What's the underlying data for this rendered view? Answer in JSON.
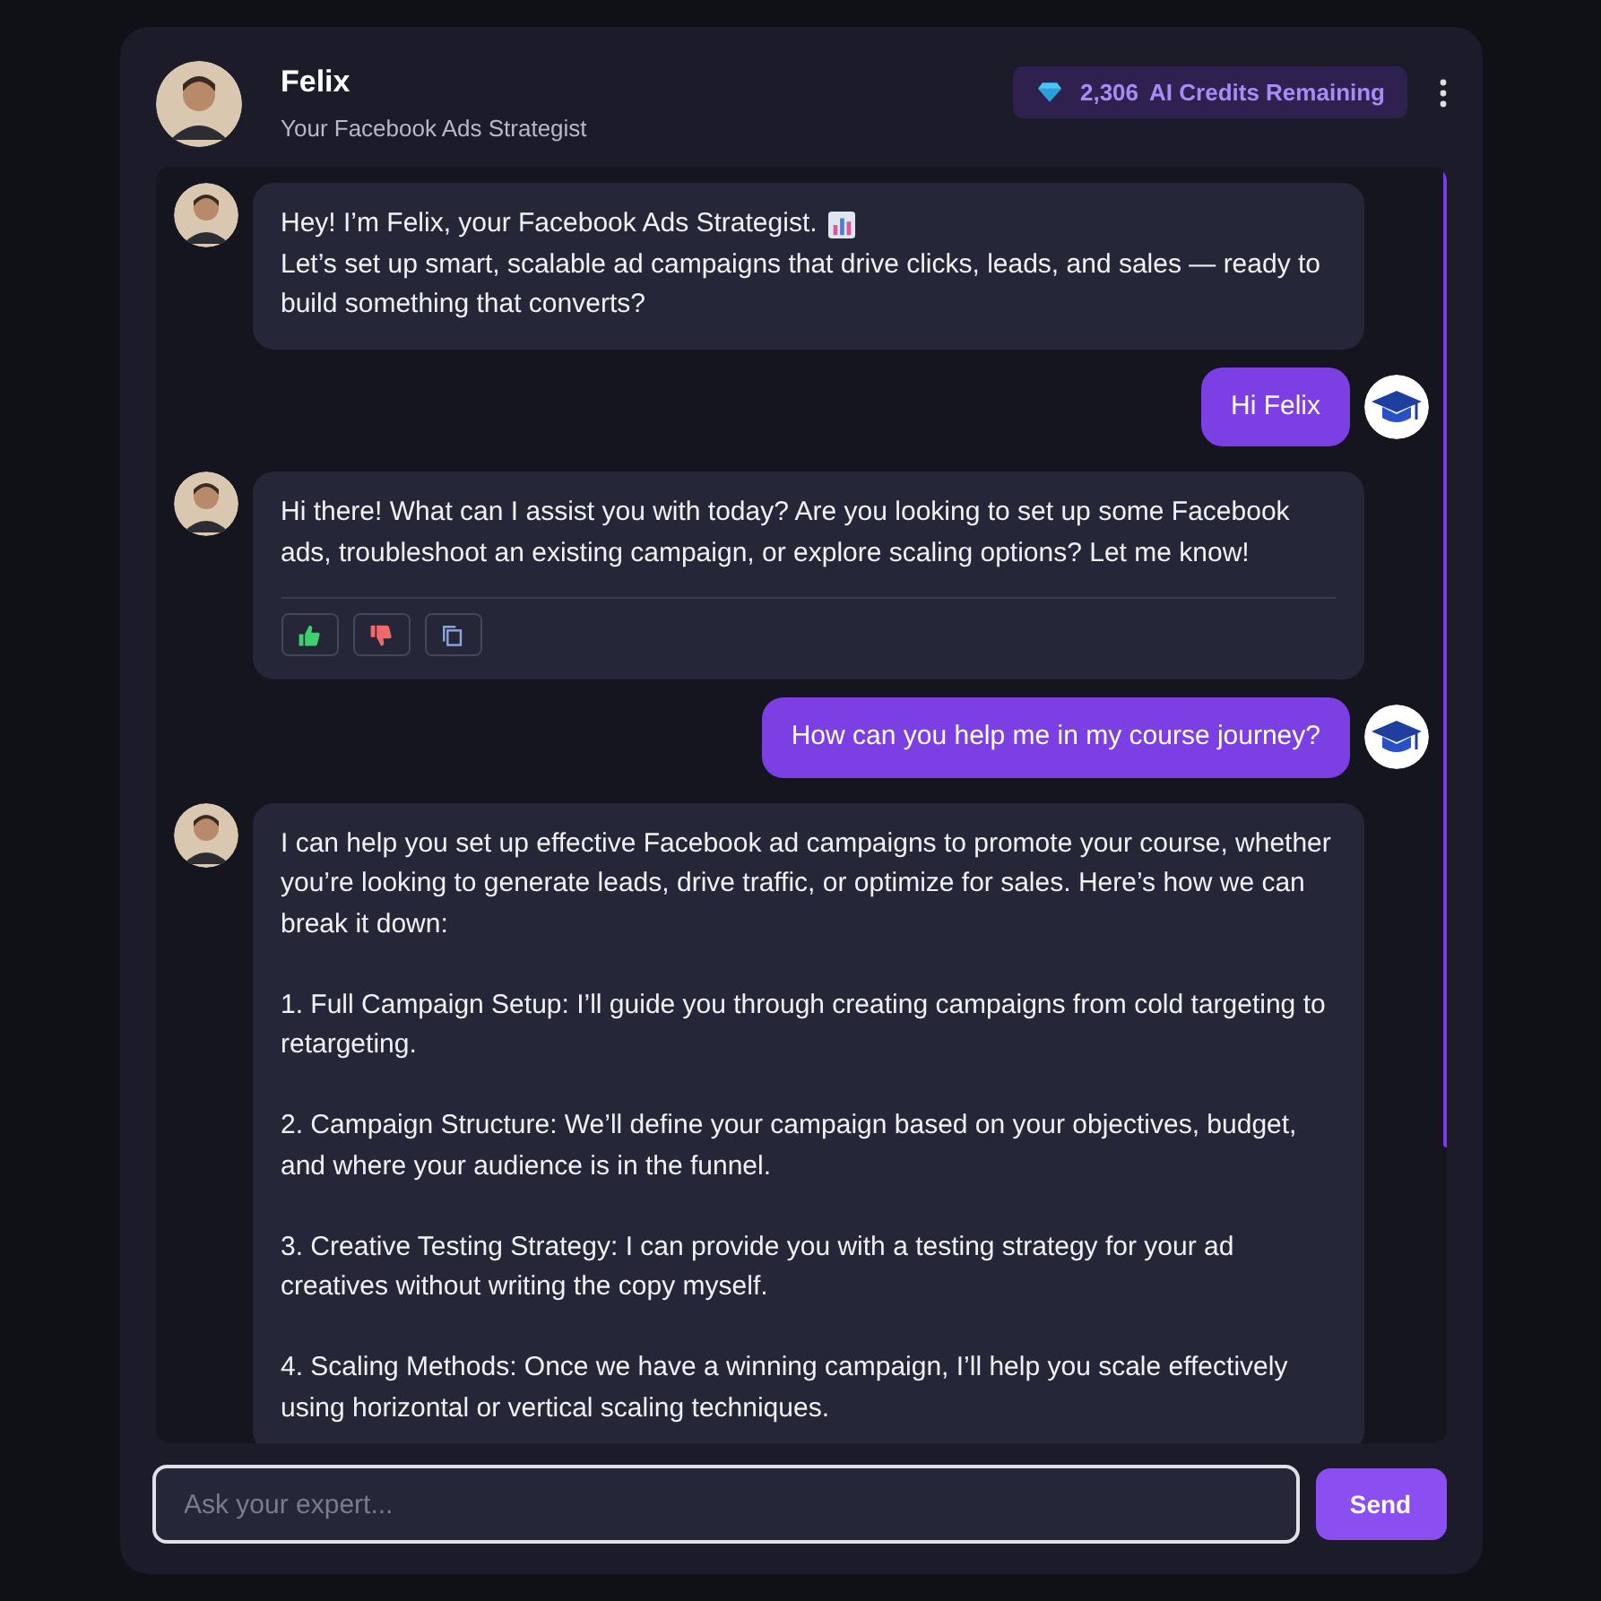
{
  "header": {
    "name": "Felix",
    "subtitle": "Your Facebook Ads Strategist",
    "credits": {
      "amount": "2,306",
      "label": "AI Credits Remaining"
    }
  },
  "messages": [
    {
      "kind": "bot",
      "headline": "Hey! I’m Felix, your Facebook Ads Strategist.",
      "headline_icon": true,
      "text": "Let’s set up smart, scalable ad campaigns that drive clicks, leads, and sales — ready to build something that converts?"
    },
    {
      "kind": "user",
      "text": "Hi Felix"
    },
    {
      "kind": "bot",
      "text": "Hi there! What can I assist you with today? Are you looking to set up some Facebook ads, troubleshoot an existing campaign, or explore scaling options? Let me know!",
      "feedback": true
    },
    {
      "kind": "user",
      "text": "How can you help me in my course journey?"
    },
    {
      "kind": "bot",
      "text": "I can help you set up effective Facebook ad campaigns to promote your course, whether you’re looking to generate leads, drive traffic, or optimize for sales. Here’s how we can break it down:\n\n1. Full Campaign Setup: I’ll guide you through creating campaigns from cold targeting to retargeting.\n\n2. Campaign Structure: We’ll define your campaign based on your objectives, budget, and where your audience is in the funnel.\n\n3. Creative Testing Strategy: I can provide you with a testing strategy for your ad creatives without writing the copy myself.\n\n4. Scaling Methods: Once we have a winning campaign, I’ll help you scale effectively using horizontal or vertical scaling techniques."
    }
  ],
  "input": {
    "placeholder": "Ask your expert..."
  },
  "send_button": "Send"
}
